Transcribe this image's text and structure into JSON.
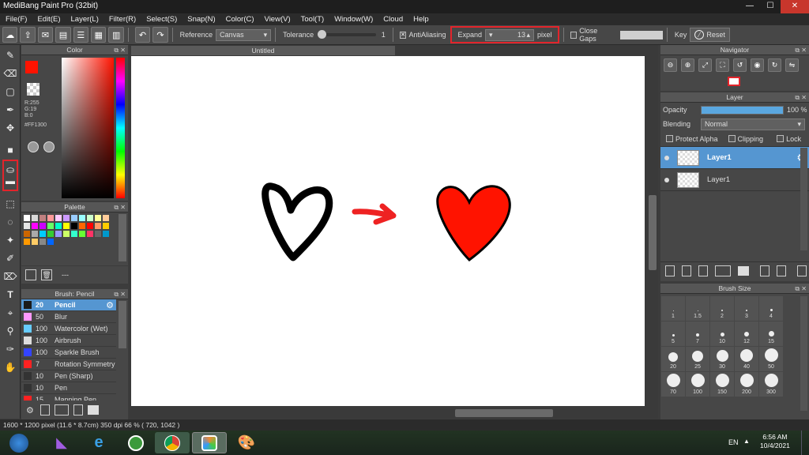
{
  "window": {
    "title": "MediBang Paint Pro (32bit)",
    "minimize": "—",
    "maximize": "☐",
    "close": "✕"
  },
  "menu": [
    "File(F)",
    "Edit(E)",
    "Layer(L)",
    "Filter(R)",
    "Select(S)",
    "Snap(N)",
    "Color(C)",
    "View(V)",
    "Tool(T)",
    "Window(W)",
    "Cloud",
    "Help"
  ],
  "toolbar": {
    "reference_label": "Reference",
    "reference_value": "Canvas",
    "tolerance_label": "Tolerance",
    "tolerance_value": "1",
    "antialiasing_label": "AntiAliasing",
    "expand_label": "Expand",
    "expand_value": "13",
    "expand_unit": "pixel",
    "close_gaps_label": "Close Gaps",
    "key_label": "Key",
    "reset_label": "Reset"
  },
  "color_panel": {
    "title": "Color",
    "r": "R:255",
    "g": "G:19",
    "b": "B:0",
    "hex": "#FF1300",
    "primary_color": "#ff1300"
  },
  "palette_panel": {
    "title": "Palette",
    "name": "---",
    "swatches": [
      "#ffffff",
      "#d9d9d9",
      "#c08080",
      "#ff9999",
      "#ffccff",
      "#cc99ff",
      "#99ccff",
      "#99ffff",
      "#ccffcc",
      "#ffff99",
      "#ffcc99",
      "#e6e6e6",
      "#ff00ff",
      "#cc00ff",
      "#66ff66",
      "#00ffcc",
      "#ffff00",
      "#000000",
      "#ff6600",
      "#ff0000",
      "#ff9966",
      "#ffcc00",
      "#cc6600",
      "#aaaaaa",
      "#00ccff",
      "#33cc33",
      "#9999ff",
      "#ccff66",
      "#33ffcc",
      "#66ff33",
      "#ff3366",
      "#666666",
      "#0099cc",
      "#ff9900",
      "#ffcc66",
      "#888888",
      "#0066ff"
    ]
  },
  "brush_panel": {
    "title": "Brush: Pencil",
    "items": [
      {
        "size": "20",
        "name": "Pencil",
        "color": "#1a1a1a"
      },
      {
        "size": "50",
        "name": "Blur",
        "color": "#ff99ff"
      },
      {
        "size": "100",
        "name": "Watercolor (Wet)",
        "color": "#66ccff"
      },
      {
        "size": "100",
        "name": "Airbrush",
        "color": "#dddddd"
      },
      {
        "size": "100",
        "name": "Sparkle Brush",
        "color": "#3344ff"
      },
      {
        "size": "7",
        "name": "Rotation Symmetry",
        "color": "#ff2222"
      },
      {
        "size": "10",
        "name": "Pen (Sharp)",
        "color": "#333333"
      },
      {
        "size": "10",
        "name": "Pen",
        "color": "#333333"
      },
      {
        "size": "15",
        "name": "Mapping Pen",
        "color": "#ff2222"
      }
    ]
  },
  "canvas": {
    "tab": "Untitled"
  },
  "navigator": {
    "title": "Navigator"
  },
  "layer_panel": {
    "title": "Layer",
    "opacity_label": "Opacity",
    "opacity_value": "100 %",
    "opacity_fraction": 1.0,
    "blending_label": "Blending",
    "blending_value": "Normal",
    "protect_alpha": "Protect Alpha",
    "clipping": "Clipping",
    "lock": "Lock",
    "layers": [
      "Layer1",
      "Layer1"
    ]
  },
  "brush_size_panel": {
    "title": "Brush Size",
    "sizes": [
      "1",
      "1.5",
      "2",
      "3",
      "4",
      "5",
      "7",
      "10",
      "12",
      "15",
      "20",
      "25",
      "30",
      "40",
      "50",
      "70",
      "100",
      "150",
      "200",
      "300"
    ]
  },
  "status": {
    "text": "1600 * 1200 pixel   (11.6 * 8.7cm)   350 dpi   66 %   ( 720, 1042 )"
  },
  "taskbar": {
    "lang": "EN",
    "time": "6:56 AM",
    "date": "10/4/2021"
  }
}
